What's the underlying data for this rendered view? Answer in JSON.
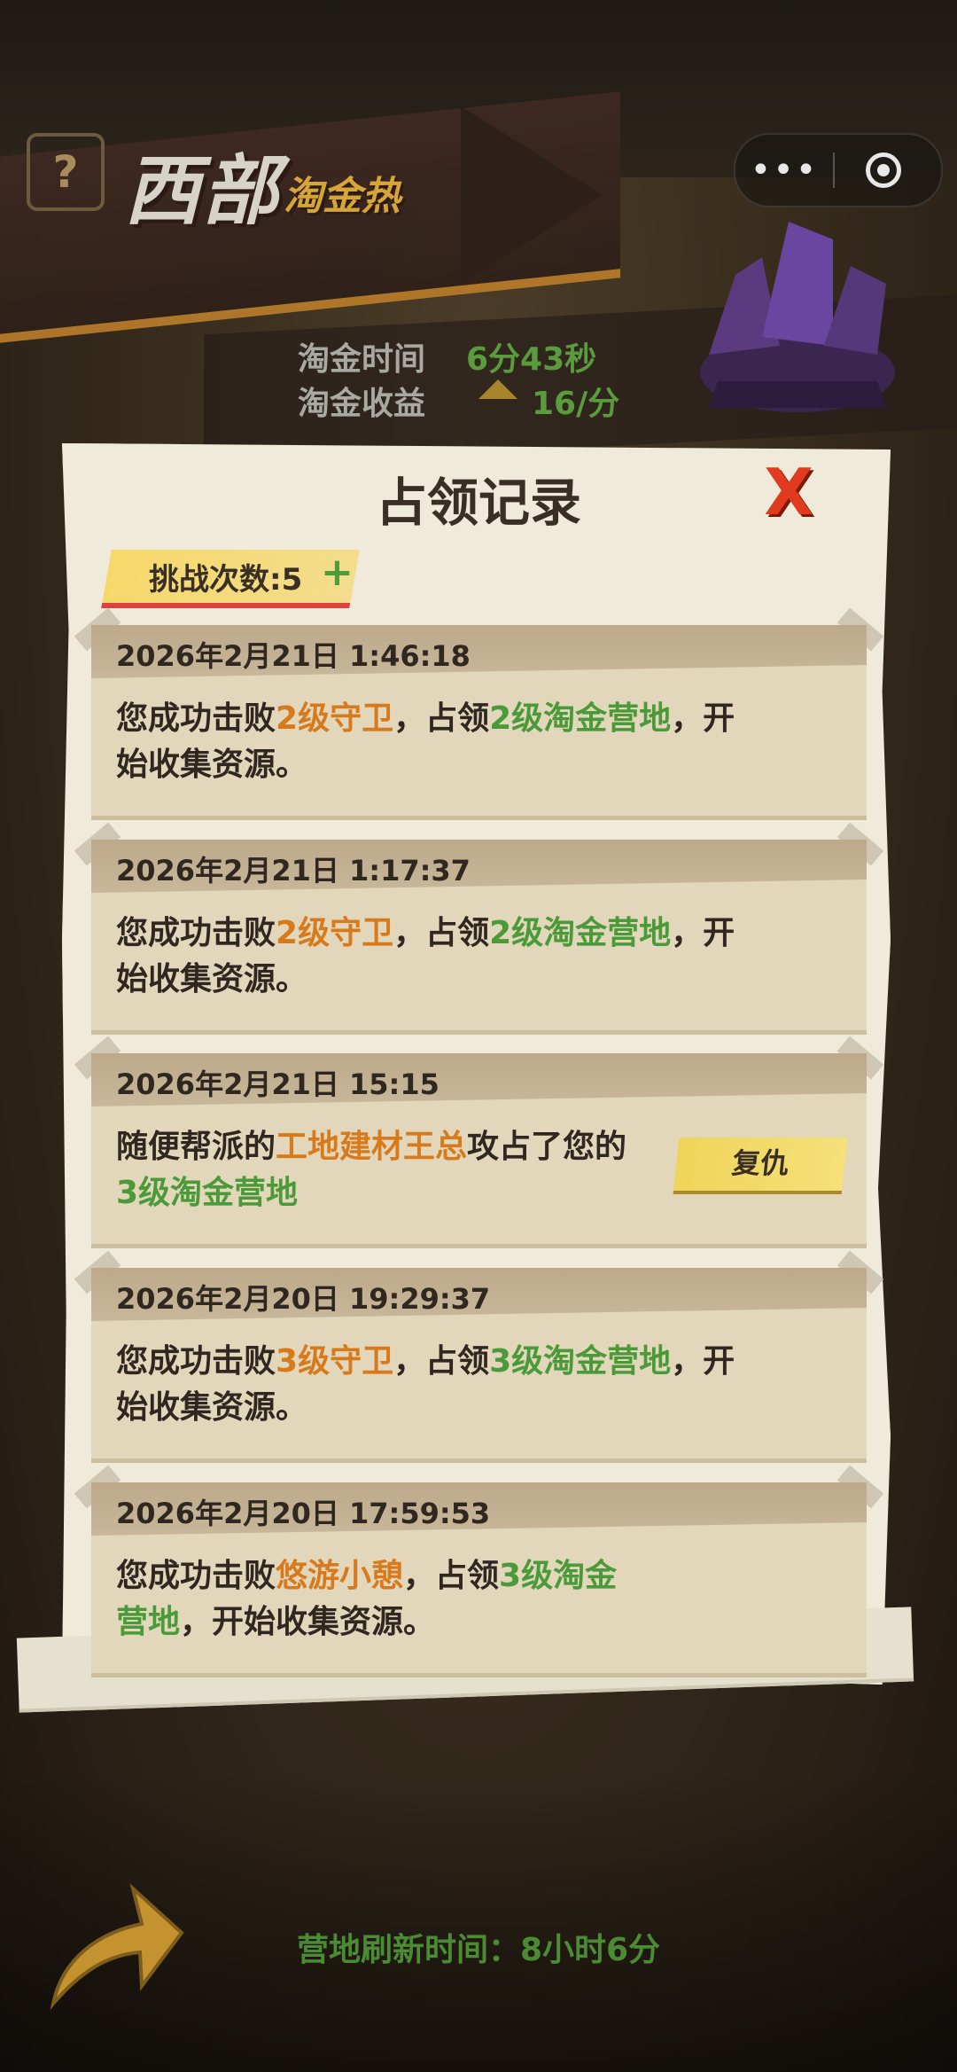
{
  "header": {
    "title": "西部",
    "subtitle": "淘金热",
    "help_icon": "question-icon",
    "capsule": {
      "more_icon": "more-dots-icon",
      "close_icon": "target-close-icon",
      "more_text": "•••"
    }
  },
  "info": {
    "time_label": "淘金时间",
    "time_value": "6分43秒",
    "income_label": "淘金收益",
    "income_value": "16/分"
  },
  "panel": {
    "title": "占领记录",
    "close": "X",
    "challenge_label": "挑战次数:5",
    "challenge_plus": "+",
    "records": [
      {
        "date": "2026年2月21日 1:46:18",
        "p1": "您成功击败",
        "h1": "2级守卫",
        "p2": "，占领",
        "h2": "2级淘金营地",
        "p3": "，开始收集资源。"
      },
      {
        "date": "2026年2月21日 1:17:37",
        "p1": "您成功击败",
        "h1": "2级守卫",
        "p2": "，占领",
        "h2": "2级淘金营地",
        "p3": "，开始收集资源。"
      },
      {
        "date": "2026年2月21日 15:15",
        "p1": "随便帮派的",
        "h1": "工地建材王总",
        "p2": "攻占了您的",
        "h2": "3级淘金营地",
        "p3": "",
        "action": "复仇"
      },
      {
        "date": "2026年2月20日 19:29:37",
        "p1": "您成功击败",
        "h1": "3级守卫",
        "p2": "，占领",
        "h2": "3级淘金营地",
        "p3": "，开始收集资源。"
      },
      {
        "date": "2026年2月20日 17:59:53",
        "p1": "您成功击败",
        "h1": "悠游小憩",
        "p2": "，占领",
        "h2": "3级淘金营地",
        "p3": "，开始收集资源。"
      }
    ]
  },
  "footer": {
    "refresh_label": "营地刷新时间：8小时6分"
  },
  "colors": {
    "accent_orange": "#d67a1c",
    "accent_green": "#4b9a3a",
    "close_red": "#e23a1f"
  }
}
